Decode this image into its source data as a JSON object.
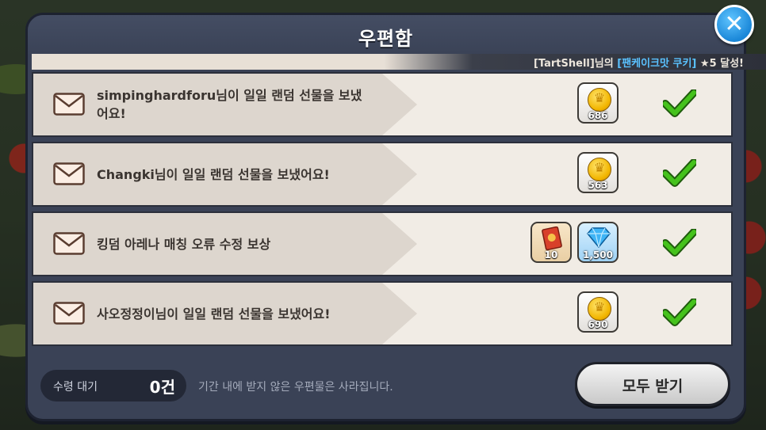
{
  "window": {
    "title": "우편함",
    "close_icon": "close-icon"
  },
  "ticker": {
    "prefix": "[TartShell]님의 ",
    "highlight": "[팬케이크맛 쿠키]",
    "suffix": " ★5 달성!"
  },
  "mail_items": [
    {
      "message": "simpinghardforu님이 일일 랜덤 선물을 보냈어요!",
      "rewards": [
        {
          "icon": "gold-coin-icon",
          "count": "686"
        }
      ]
    },
    {
      "message": "Changki님이 일일 랜덤 선물을 보냈어요!",
      "rewards": [
        {
          "icon": "gold-coin-icon",
          "count": "563"
        }
      ]
    },
    {
      "message": "킹덤 아레나 매칭 오류 수정 보상",
      "rewards": [
        {
          "icon": "ticket-card-icon",
          "count": "10"
        },
        {
          "icon": "crystal-gem-icon",
          "count": "1,500"
        }
      ]
    },
    {
      "message": "사오정정이님이 일일 랜덤 선물을 보냈어요!",
      "rewards": [
        {
          "icon": "gold-coin-icon",
          "count": "690"
        }
      ]
    }
  ],
  "footer": {
    "pending_label": "수령 대기",
    "pending_count": "0건",
    "notice": "기간 내에 받지 않은 우편물은 사라집니다.",
    "receive_all_label": "모두 받기"
  },
  "colors": {
    "check": "#45c21c",
    "close_button": "#1a87d8",
    "highlight": "#5ac2ff"
  }
}
